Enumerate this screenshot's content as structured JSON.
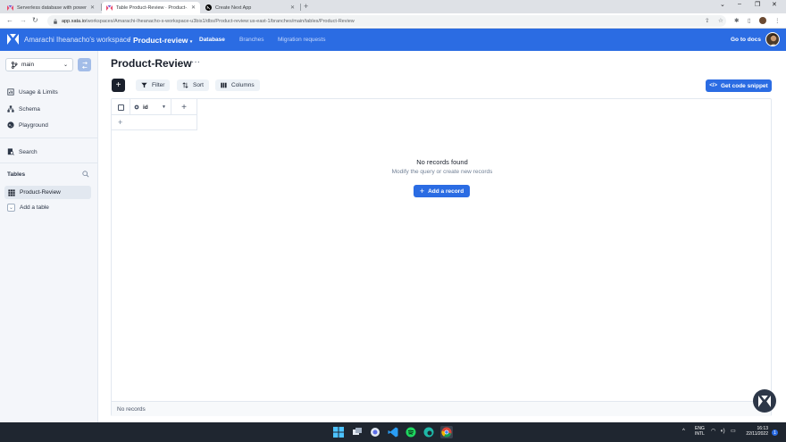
{
  "browser": {
    "tabs": [
      {
        "label": "Serverless database with powerf…",
        "active": false
      },
      {
        "label": "Table Product-Review · Product-…",
        "active": true
      },
      {
        "label": "Create Next App",
        "active": false
      }
    ],
    "url_host": "app.xata.io",
    "url_path": "/workspaces/Amarachi-Iheanacho-s-workspace-u3bis1/dbs/Product-review:us-east-1/branches/main/tables/Product-Review"
  },
  "header": {
    "workspace": "Amarachi Iheanacho's workspace",
    "separator": "/",
    "database": "Product-review",
    "nav": [
      "Database",
      "Branches",
      "Migration requests"
    ],
    "go_to_docs": "Go to docs"
  },
  "sidebar": {
    "branch": "main",
    "items": [
      {
        "label": "Usage & Limits",
        "icon": "usage-icon"
      },
      {
        "label": "Schema",
        "icon": "schema-icon"
      },
      {
        "label": "Playground",
        "icon": "playground-icon"
      },
      {
        "label": "Search",
        "icon": "search-doc-icon"
      }
    ],
    "tables_header": "Tables",
    "tables": [
      "Product-Review"
    ],
    "add_table": "Add a table"
  },
  "main": {
    "title": "Product-Review",
    "title_more": "···",
    "toolbar": {
      "filter": "Filter",
      "sort": "Sort",
      "columns": "Columns",
      "snippet": "Get code snippet"
    },
    "columns": [
      "id"
    ],
    "empty_title": "No records found",
    "empty_sub": "Modify the query or create new records",
    "add_record": "Add a record",
    "footer": "No records"
  },
  "taskbar": {
    "lang": "ENG",
    "lang2": "INTL",
    "time": "16:13",
    "date": "22/11/2022",
    "notifications": "1"
  },
  "colors": {
    "accent": "#2b6ce3",
    "header_bg": "#2b6ce3",
    "sidebar_bg": "#f4f6fa",
    "taskbar_bg": "#1f2630"
  }
}
